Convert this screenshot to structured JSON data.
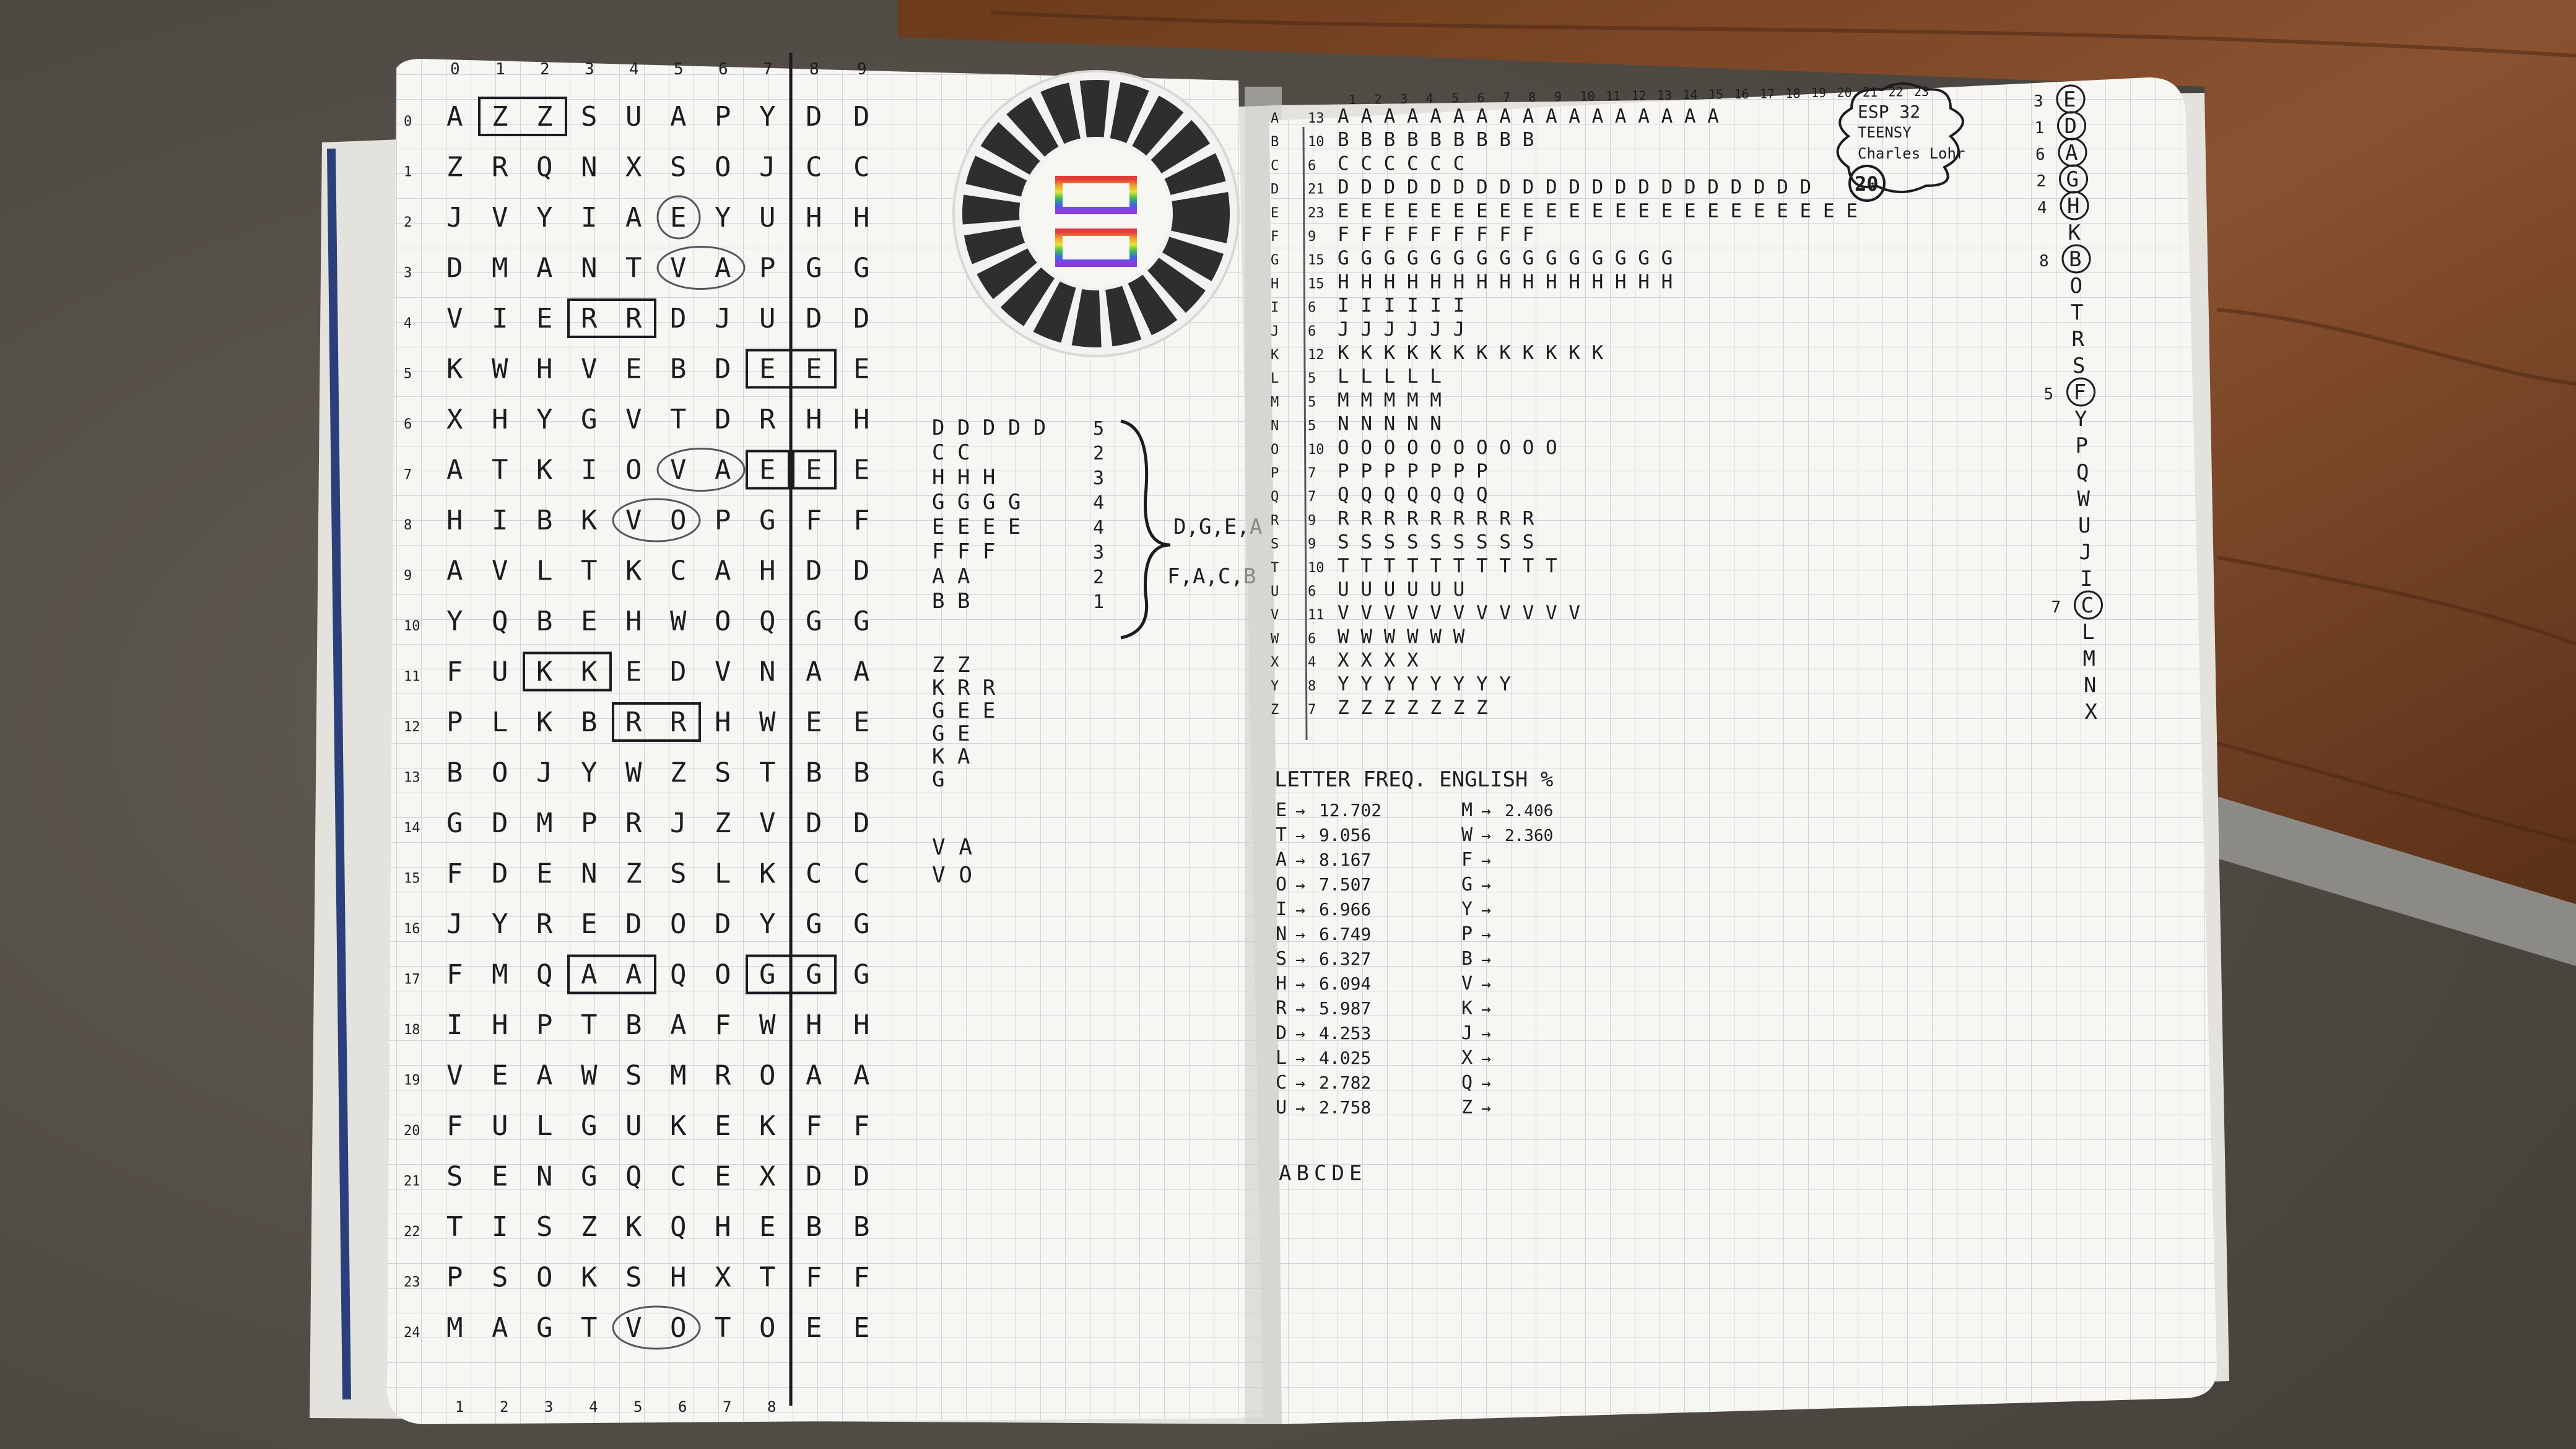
{
  "scene": {
    "palette": {
      "floor": "#57524a",
      "wood": "#7a4622",
      "paper": "#f6f6f3",
      "grid": "#c9d0d8",
      "ink": "#1c1c20",
      "pencil": "#55575c",
      "sticker_ring": "#2e2e30"
    }
  },
  "left_page": {
    "top_index": [
      "0",
      "1",
      "2",
      "3",
      "4",
      "5",
      "6",
      "7",
      "8",
      "9"
    ],
    "bottom_index": [
      "1",
      "2",
      "3",
      "4",
      "5",
      "6",
      "7",
      "8"
    ],
    "rows": [
      {
        "label": "0",
        "letters": [
          "A",
          "Z",
          "Z",
          "S",
          "U",
          "A",
          "P",
          "Y",
          "D",
          "D"
        ]
      },
      {
        "label": "1",
        "letters": [
          "Z",
          "R",
          "Q",
          "N",
          "X",
          "S",
          "O",
          "J",
          "C",
          "C"
        ]
      },
      {
        "label": "2",
        "letters": [
          "J",
          "V",
          "Y",
          "I",
          "A",
          "E",
          "Y",
          "U",
          "H",
          "H"
        ]
      },
      {
        "label": "3",
        "letters": [
          "D",
          "M",
          "A",
          "N",
          "T",
          "V",
          "A",
          "P",
          "G",
          "G"
        ]
      },
      {
        "label": "4",
        "letters": [
          "V",
          "I",
          "E",
          "R",
          "R",
          "D",
          "J",
          "U",
          "D",
          "D"
        ]
      },
      {
        "label": "5",
        "letters": [
          "K",
          "W",
          "H",
          "V",
          "E",
          "B",
          "D",
          "E",
          "E",
          "E"
        ]
      },
      {
        "label": "6",
        "letters": [
          "X",
          "H",
          "Y",
          "G",
          "V",
          "T",
          "D",
          "R",
          "H",
          "H"
        ]
      },
      {
        "label": "7",
        "letters": [
          "A",
          "T",
          "K",
          "I",
          "O",
          "V",
          "A",
          "E",
          "E",
          "E"
        ]
      },
      {
        "label": "8",
        "letters": [
          "H",
          "I",
          "B",
          "K",
          "V",
          "O",
          "P",
          "G",
          "F",
          "F"
        ]
      },
      {
        "label": "9",
        "letters": [
          "A",
          "V",
          "L",
          "T",
          "K",
          "C",
          "A",
          "H",
          "D",
          "D"
        ]
      },
      {
        "label": "10",
        "letters": [
          "Y",
          "Q",
          "B",
          "E",
          "H",
          "W",
          "O",
          "Q",
          "G",
          "G"
        ]
      },
      {
        "label": "11",
        "letters": [
          "F",
          "U",
          "K",
          "K",
          "E",
          "D",
          "V",
          "N",
          "A",
          "A"
        ]
      },
      {
        "label": "12",
        "letters": [
          "P",
          "L",
          "K",
          "B",
          "R",
          "R",
          "H",
          "W",
          "E",
          "E"
        ]
      },
      {
        "label": "13",
        "letters": [
          "B",
          "O",
          "J",
          "Y",
          "W",
          "Z",
          "S",
          "T",
          "B",
          "B"
        ]
      },
      {
        "label": "14",
        "letters": [
          "G",
          "D",
          "M",
          "P",
          "R",
          "J",
          "Z",
          "V",
          "D",
          "D"
        ]
      },
      {
        "label": "15",
        "letters": [
          "F",
          "D",
          "E",
          "N",
          "Z",
          "S",
          "L",
          "K",
          "C",
          "C"
        ]
      },
      {
        "label": "16",
        "letters": [
          "J",
          "Y",
          "R",
          "E",
          "D",
          "O",
          "D",
          "Y",
          "G",
          "G"
        ]
      },
      {
        "label": "17",
        "letters": [
          "F",
          "M",
          "Q",
          "A",
          "A",
          "Q",
          "O",
          "G",
          "G",
          "G"
        ]
      },
      {
        "label": "18",
        "letters": [
          "I",
          "H",
          "P",
          "T",
          "B",
          "A",
          "F",
          "W",
          "H",
          "H"
        ]
      },
      {
        "label": "19",
        "letters": [
          "V",
          "E",
          "A",
          "W",
          "S",
          "M",
          "R",
          "O",
          "A",
          "A"
        ]
      },
      {
        "label": "20",
        "letters": [
          "F",
          "U",
          "L",
          "G",
          "U",
          "K",
          "E",
          "K",
          "F",
          "F"
        ]
      },
      {
        "label": "21",
        "letters": [
          "S",
          "E",
          "N",
          "G",
          "Q",
          "C",
          "E",
          "X",
          "D",
          "D"
        ]
      },
      {
        "label": "22",
        "letters": [
          "T",
          "I",
          "S",
          "Z",
          "K",
          "Q",
          "H",
          "E",
          "B",
          "B"
        ]
      },
      {
        "label": "23",
        "letters": [
          "P",
          "S",
          "O",
          "K",
          "S",
          "H",
          "X",
          "T",
          "F",
          "F"
        ]
      },
      {
        "label": "24",
        "letters": [
          "M",
          "A",
          "G",
          "T",
          "V",
          "O",
          "T",
          "O",
          "E",
          "E"
        ]
      }
    ],
    "tally": [
      {
        "text": "D D D D D",
        "count": "5"
      },
      {
        "text": "C C",
        "count": "2"
      },
      {
        "text": "H H H",
        "count": "3"
      },
      {
        "text": "G G G G",
        "count": "4"
      },
      {
        "text": "E E E E",
        "count": "4"
      },
      {
        "text": "F F F",
        "count": "3"
      },
      {
        "text": "A A",
        "count": "2"
      },
      {
        "text": "B B",
        "count": "1"
      }
    ],
    "tally_note": [
      "D,G,E,A",
      "F,A,C,B"
    ],
    "pairs": [
      "Z Z",
      "K R R",
      "G E E",
      "G E",
      "K A",
      "G"
    ],
    "va_vo": [
      "V A",
      "V O"
    ]
  },
  "right_page": {
    "header_numbers": [
      "1",
      "2",
      "3",
      "4",
      "5",
      "6",
      "7",
      "8",
      "9",
      "10",
      "11",
      "12",
      "13",
      "14",
      "15",
      "16",
      "17",
      "18",
      "19",
      "20",
      "21",
      "22",
      "23"
    ],
    "rows": [
      {
        "letter": "A",
        "count": "13",
        "text": "A A A A A A A A A A A A A A A A A"
      },
      {
        "letter": "B",
        "count": "10",
        "text": "B B B B B B B B B"
      },
      {
        "letter": "C",
        "count": "6",
        "text": "C C C C C C"
      },
      {
        "letter": "D",
        "count": "21",
        "text": "D D D D D D D D D D D D D D D D D D D D D"
      },
      {
        "letter": "E",
        "count": "23",
        "text": "E E E E E E E E E E E E E E E E E E E E E E E"
      },
      {
        "letter": "F",
        "count": "9",
        "text": "F F F F F F F F F"
      },
      {
        "letter": "G",
        "count": "15",
        "text": "G G G G G G G G G G G G G G G"
      },
      {
        "letter": "H",
        "count": "15",
        "text": "H H H H H H H H H H H H H H H"
      },
      {
        "letter": "I",
        "count": "6",
        "text": "I I I I I I"
      },
      {
        "letter": "J",
        "count": "6",
        "text": "J J J J J J"
      },
      {
        "letter": "K",
        "count": "12",
        "text": "K K K K K K K K K K K K"
      },
      {
        "letter": "L",
        "count": "5",
        "text": "L L L L L"
      },
      {
        "letter": "M",
        "count": "5",
        "text": "M M M M M"
      },
      {
        "letter": "N",
        "count": "5",
        "text": "N N N N N"
      },
      {
        "letter": "O",
        "count": "10",
        "text": "O O O O O O O O O O"
      },
      {
        "letter": "P",
        "count": "7",
        "text": "P P P P P P P"
      },
      {
        "letter": "Q",
        "count": "7",
        "text": "Q Q Q Q Q Q Q"
      },
      {
        "letter": "R",
        "count": "9",
        "text": "R R R R R R R R R"
      },
      {
        "letter": "S",
        "count": "9",
        "text": "S S S S S S S S S"
      },
      {
        "letter": "T",
        "count": "10",
        "text": "T T T T T T T T T T"
      },
      {
        "letter": "U",
        "count": "6",
        "text": "U U U U U U"
      },
      {
        "letter": "V",
        "count": "11",
        "text": "V V V V V V V V V V V"
      },
      {
        "letter": "W",
        "count": "6",
        "text": "W W W W W W"
      },
      {
        "letter": "X",
        "count": "4",
        "text": "X X X X"
      },
      {
        "letter": "Y",
        "count": "8",
        "text": "Y Y Y Y Y Y Y Y"
      },
      {
        "letter": "Z",
        "count": "7",
        "text": "Z Z Z Z Z Z Z"
      }
    ],
    "cloud": [
      "ESP 32",
      "TEENSY",
      "Charles Lohr",
      "20"
    ],
    "freq_title": "LETTER FREQ. ENGLISH %",
    "freq_left": [
      {
        "letter": "E",
        "value": "12.702"
      },
      {
        "letter": "T",
        "value": "9.056"
      },
      {
        "letter": "A",
        "value": "8.167"
      },
      {
        "letter": "O",
        "value": "7.507"
      },
      {
        "letter": "I",
        "value": "6.966"
      },
      {
        "letter": "N",
        "value": "6.749"
      },
      {
        "letter": "S",
        "value": "6.327"
      },
      {
        "letter": "H",
        "value": "6.094"
      },
      {
        "letter": "R",
        "value": "5.987"
      },
      {
        "letter": "D",
        "value": "4.253"
      },
      {
        "letter": "L",
        "value": "4.025"
      },
      {
        "letter": "C",
        "value": "2.782"
      },
      {
        "letter": "U",
        "value": "2.758"
      }
    ],
    "freq_right": [
      {
        "letter": "M",
        "value": "2.406"
      },
      {
        "letter": "W",
        "value": "2.360"
      },
      {
        "letter": "F",
        "value": ""
      },
      {
        "letter": "G",
        "value": ""
      },
      {
        "letter": "Y",
        "value": ""
      },
      {
        "letter": "P",
        "value": ""
      },
      {
        "letter": "B",
        "value": ""
      },
      {
        "letter": "V",
        "value": ""
      },
      {
        "letter": "K",
        "value": ""
      },
      {
        "letter": "J",
        "value": ""
      },
      {
        "letter": "X",
        "value": ""
      },
      {
        "letter": "Q",
        "value": ""
      },
      {
        "letter": "Z",
        "value": ""
      }
    ],
    "abc": "ABCDE",
    "right_column": [
      {
        "num": "3",
        "letter": "E",
        "circled": true
      },
      {
        "num": "1",
        "letter": "D",
        "circled": true
      },
      {
        "num": "6",
        "letter": "A",
        "circled": true
      },
      {
        "num": "2",
        "letter": "G",
        "circled": true
      },
      {
        "num": "4",
        "letter": "H",
        "circled": true
      },
      {
        "num": "",
        "letter": "K",
        "circled": false
      },
      {
        "num": "8",
        "letter": "B",
        "circled": true
      },
      {
        "num": "",
        "letter": "O",
        "circled": false
      },
      {
        "num": "",
        "letter": "T",
        "circled": false
      },
      {
        "num": "",
        "letter": "R",
        "circled": false
      },
      {
        "num": "",
        "letter": "S",
        "circled": false
      },
      {
        "num": "5",
        "letter": "F",
        "circled": true
      },
      {
        "num": "",
        "letter": "Y",
        "circled": false
      },
      {
        "num": "",
        "letter": "P",
        "circled": false
      },
      {
        "num": "",
        "letter": "Q",
        "circled": false
      },
      {
        "num": "",
        "letter": "W",
        "circled": false
      },
      {
        "num": "",
        "letter": "U",
        "circled": false
      },
      {
        "num": "",
        "letter": "J",
        "circled": false
      },
      {
        "num": "",
        "letter": "I",
        "circled": false
      },
      {
        "num": "7",
        "letter": "C",
        "circled": true
      },
      {
        "num": "",
        "letter": "L",
        "circled": false
      },
      {
        "num": "",
        "letter": "M",
        "circled": false
      },
      {
        "num": "",
        "letter": "N",
        "circled": false
      },
      {
        "num": "",
        "letter": "X",
        "circled": false
      }
    ]
  }
}
